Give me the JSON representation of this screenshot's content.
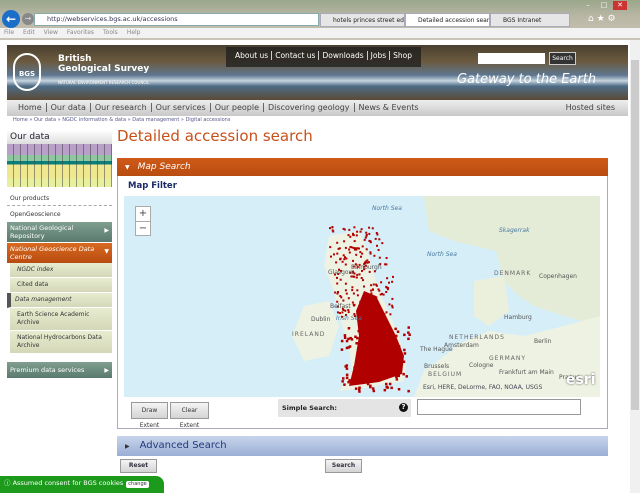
{
  "browser": {
    "url": "http://webservices.bgs.ac.uk/accessions",
    "tabs": [
      "hotels princes street edinb...",
      "Detailed accession sear...",
      "BGS Intranet"
    ],
    "menu": [
      "File",
      "Edit",
      "View",
      "Favorites",
      "Tools",
      "Help"
    ]
  },
  "header": {
    "org_line1": "British",
    "org_line2": "Geological Survey",
    "council": "NATURAL ENVIRONMENT RESEARCH COUNCIL",
    "logo_text": "BGS",
    "top_links": [
      "About us",
      "Contact us",
      "Downloads",
      "Jobs",
      "Shop"
    ],
    "search_button": "Search",
    "tagline": "Gateway to the Earth"
  },
  "nav": {
    "items": [
      "Home",
      "Our data",
      "Our research",
      "Our services",
      "Our people",
      "Discovering geology",
      "News  &  Events"
    ],
    "hosted": "Hosted sites"
  },
  "breadcrumb": [
    "Home",
    "Our data",
    "NGDC information & data",
    "Data management",
    "Digital accessions"
  ],
  "sidebar": {
    "heading": "Our data",
    "plain": [
      "Our products",
      "OpenGeoscience"
    ],
    "ngr": "National Geological Repository",
    "ngdc": "National Geoscience Data Centre",
    "sub": [
      "NGDC index",
      "Cited data",
      "Data management",
      "Earth Science Academic Archive",
      "National Hydrocarbons Data Archive"
    ],
    "premium": "Premium data services"
  },
  "main": {
    "title": "Detailed accession search",
    "map_search": "Map Search",
    "map_filter": "Map Filter",
    "draw_extent": "Draw Extent",
    "clear_extent": "Clear Extent",
    "simple_search": "Simple Search:",
    "advanced_search": "Advanced Search",
    "reset": "Reset",
    "search": "Search"
  },
  "map": {
    "attribution": "Esri, HERE, DeLorme, FAO, NOAA, USGS",
    "esri": "esri",
    "labels": {
      "north_sea_1": "North Sea",
      "north_sea_2": "North Sea",
      "skagerrak": "Skagerrak",
      "denmark": "DENMARK",
      "copenhagen": "Copenhagen",
      "hamburg": "Hamburg",
      "berlin": "Berlin",
      "netherlands": "NETHERLANDS",
      "amsterdam": "Amsterdam",
      "hague": "The Hague",
      "brussels": "Brussels",
      "belgium": "BELGIUM",
      "cologne": "Cologne",
      "germany": "GERMANY",
      "frankfurt": "Frankfurt am Main",
      "prague": "Prague",
      "ireland": "IRELAND",
      "dublin": "Dublin",
      "belfast": "Belfast",
      "edinburgh": "Edinburgh",
      "glasgow": "Glasgow",
      "irish_sea": "Irish Sea"
    },
    "dot_color": "#b00000"
  },
  "cookie": {
    "text": "Assumed consent for BGS cookies",
    "change": "change"
  }
}
